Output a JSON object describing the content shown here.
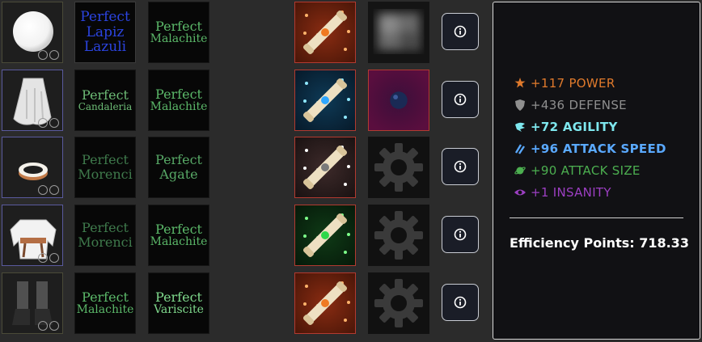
{
  "slots": [
    {
      "item": "orb",
      "item_border": "#4a4a38",
      "gem1": {
        "lines": [
          "Perfect",
          "Lapiz",
          "Lazuli"
        ],
        "color": "#2b44e0",
        "border": "#3a3a3a"
      },
      "gem2": {
        "lines": [
          "Perfect",
          "Malachite"
        ],
        "color": "#5bb869",
        "border": "#161616"
      },
      "scroll": "orange",
      "extra": "blurred"
    },
    {
      "item": "cape",
      "item_border": "#5a5a9e",
      "gem1": {
        "lines": [
          "Perfect",
          "Candaleria"
        ],
        "color": "#6cba75",
        "border": "#161616"
      },
      "gem2": {
        "lines": [
          "Perfect",
          "Malachite"
        ],
        "color": "#5bb869",
        "border": "#161616"
      },
      "scroll": "cyan",
      "extra": "orb"
    },
    {
      "item": "ring",
      "item_border": "#5a5a9e",
      "gem1": {
        "lines": [
          "Perfect",
          "Morenci"
        ],
        "color": "#3f7a4c",
        "border": "#161616"
      },
      "gem2": {
        "lines": [
          "Perfect",
          "Agate"
        ],
        "color": "#57a866",
        "border": "#161616"
      },
      "scroll": "silver",
      "extra": "gear"
    },
    {
      "item": "shirt",
      "item_border": "#5a5a9e",
      "gem1": {
        "lines": [
          "Perfect",
          "Morenci"
        ],
        "color": "#3f7a4c",
        "border": "#161616"
      },
      "gem2": {
        "lines": [
          "Perfect",
          "Malachite"
        ],
        "color": "#5bb869",
        "border": "#161616"
      },
      "scroll": "green",
      "extra": "gear"
    },
    {
      "item": "boots",
      "item_border": "#4a4a38",
      "gem1": {
        "lines": [
          "Perfect",
          "Malachite"
        ],
        "color": "#5bb869",
        "border": "#161616"
      },
      "gem2": {
        "lines": [
          "Perfect",
          "Variscite"
        ],
        "color": "#7fd98c",
        "border": "#161616"
      },
      "scroll": "orange",
      "extra": "gear"
    }
  ],
  "stats": [
    {
      "text": "+117 POWER",
      "color": "#e07a2c",
      "icon": "star-burst-icon",
      "bold": false
    },
    {
      "text": "+436 DEFENSE",
      "color": "#8f8f8f",
      "icon": "shield-icon",
      "bold": false
    },
    {
      "text": "+72 AGILITY",
      "color": "#7ee7ee",
      "icon": "wing-icon",
      "bold": true
    },
    {
      "text": "+96 ATTACK SPEED",
      "color": "#5aa9ff",
      "icon": "speed-lines-icon",
      "bold": true
    },
    {
      "text": "+90 ATTACK SIZE",
      "color": "#4caf50",
      "icon": "planet-icon",
      "bold": false
    },
    {
      "text": "+1 INSANITY",
      "color": "#9c3fc2",
      "icon": "eye-icon",
      "bold": false
    }
  ],
  "efficiency": {
    "label": "Efficiency Points: 718.33"
  },
  "info_icon": "info-icon"
}
